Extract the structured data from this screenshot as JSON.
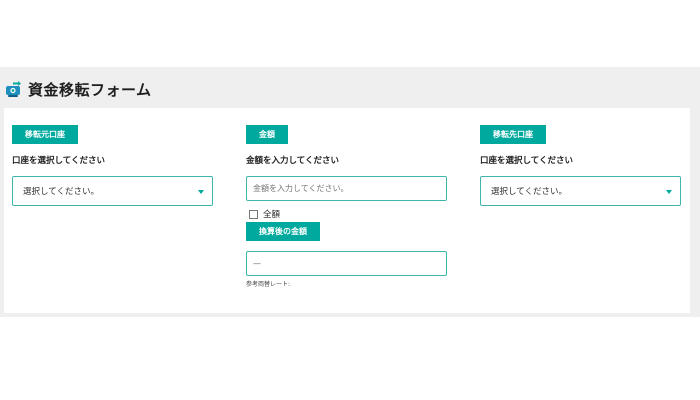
{
  "header": {
    "title": "資金移転フォーム",
    "logo_icon": "money-transfer-icon"
  },
  "theme": {
    "accent": "#00a99d",
    "band_bg": "#efefef",
    "card_bg": "#ffffff"
  },
  "source": {
    "tag": "移転元口座",
    "label": "口座を選択してください",
    "select_value": "選択してください。"
  },
  "amount": {
    "tag": "金額",
    "label": "金額を入力してください",
    "placeholder": "金額を入力してください。",
    "all_label": "全額",
    "all_checked": false,
    "converted_tag": "換算後の金額",
    "converted_value": "—",
    "rate_label": "参考両替レート:"
  },
  "destination": {
    "tag": "移転先口座",
    "label": "口座を選択してください",
    "select_value": "選択してください。"
  }
}
